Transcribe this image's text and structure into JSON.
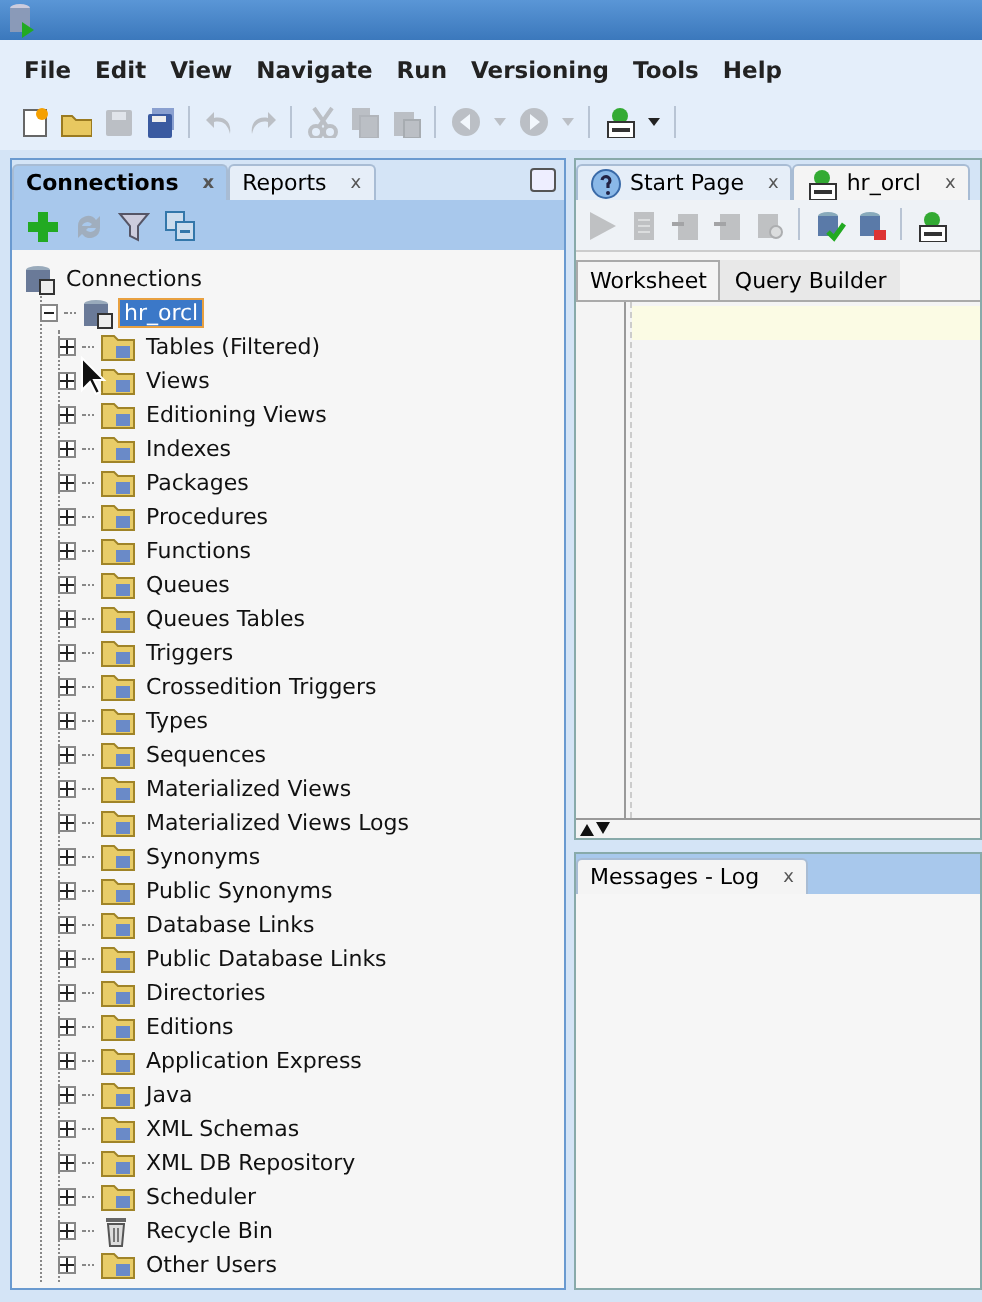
{
  "menu": [
    "File",
    "Edit",
    "View",
    "Navigate",
    "Run",
    "Versioning",
    "Tools",
    "Help"
  ],
  "toolbar": [
    {
      "kind": "new",
      "disabled": false
    },
    {
      "kind": "open",
      "disabled": false
    },
    {
      "kind": "save",
      "disabled": true
    },
    {
      "kind": "save-all",
      "disabled": false
    },
    {
      "kind": "sep"
    },
    {
      "kind": "undo",
      "disabled": true
    },
    {
      "kind": "redo",
      "disabled": true
    },
    {
      "kind": "sep"
    },
    {
      "kind": "cut",
      "disabled": true
    },
    {
      "kind": "copy",
      "disabled": true
    },
    {
      "kind": "paste",
      "disabled": true
    },
    {
      "kind": "sep"
    },
    {
      "kind": "back",
      "disabled": true
    },
    {
      "kind": "dropdown",
      "disabled": true
    },
    {
      "kind": "forward",
      "disabled": true
    },
    {
      "kind": "dropdown",
      "disabled": true
    },
    {
      "kind": "sep"
    },
    {
      "kind": "sql",
      "disabled": false
    },
    {
      "kind": "dropdown",
      "disabled": false
    },
    {
      "kind": "sep"
    }
  ],
  "left_panel": {
    "tabs": [
      {
        "label": "Connections",
        "selected": true,
        "close": "x"
      },
      {
        "label": "Reports",
        "selected": false,
        "close": "x"
      }
    ],
    "toolbar": [
      {
        "kind": "add",
        "disabled": false
      },
      {
        "kind": "refresh",
        "disabled": true
      },
      {
        "kind": "filter",
        "disabled": false
      },
      {
        "kind": "collapse",
        "disabled": false
      }
    ],
    "tree": [
      {
        "label": "Connections",
        "kind": "database",
        "selected": false,
        "children": [
          {
            "label": "hr_orcl",
            "kind": "database",
            "selected": true,
            "expanded": true,
            "children": [
              {
                "label": "Tables (Filtered)",
                "kind": "folder",
                "selected": false,
                "expanded": false
              },
              {
                "label": "Views",
                "kind": "folder",
                "selected": false,
                "expanded": false
              },
              {
                "label": "Editioning Views",
                "kind": "folder",
                "selected": false,
                "expanded": false
              },
              {
                "label": "Indexes",
                "kind": "folder",
                "selected": false,
                "expanded": false
              },
              {
                "label": "Packages",
                "kind": "folder",
                "selected": false,
                "expanded": false
              },
              {
                "label": "Procedures",
                "kind": "folder",
                "selected": false,
                "expanded": false
              },
              {
                "label": "Functions",
                "kind": "folder",
                "selected": false,
                "expanded": false
              },
              {
                "label": "Queues",
                "kind": "folder",
                "selected": false,
                "expanded": false
              },
              {
                "label": "Queues Tables",
                "kind": "folder",
                "selected": false,
                "expanded": false
              },
              {
                "label": "Triggers",
                "kind": "folder",
                "selected": false,
                "expanded": false
              },
              {
                "label": "Crossedition Triggers",
                "kind": "folder",
                "selected": false,
                "expanded": false
              },
              {
                "label": "Types",
                "kind": "folder",
                "selected": false,
                "expanded": false
              },
              {
                "label": "Sequences",
                "kind": "folder",
                "selected": false,
                "expanded": false
              },
              {
                "label": "Materialized Views",
                "kind": "folder",
                "selected": false,
                "expanded": false
              },
              {
                "label": "Materialized Views Logs",
                "kind": "folder",
                "selected": false,
                "expanded": false
              },
              {
                "label": "Synonyms",
                "kind": "folder",
                "selected": false,
                "expanded": false
              },
              {
                "label": "Public Synonyms",
                "kind": "folder",
                "selected": false,
                "expanded": false
              },
              {
                "label": "Database Links",
                "kind": "folder",
                "selected": false,
                "expanded": false
              },
              {
                "label": "Public Database Links",
                "kind": "folder",
                "selected": false,
                "expanded": false
              },
              {
                "label": "Directories",
                "kind": "folder",
                "selected": false,
                "expanded": false
              },
              {
                "label": "Editions",
                "kind": "folder",
                "selected": false,
                "expanded": false
              },
              {
                "label": "Application Express",
                "kind": "folder",
                "selected": false,
                "expanded": false
              },
              {
                "label": "Java",
                "kind": "folder",
                "selected": false,
                "expanded": false
              },
              {
                "label": "XML Schemas",
                "kind": "folder",
                "selected": false,
                "expanded": false
              },
              {
                "label": "XML DB Repository",
                "kind": "folder",
                "selected": false,
                "expanded": false
              },
              {
                "label": "Scheduler",
                "kind": "folder",
                "selected": false,
                "expanded": false
              },
              {
                "label": "Recycle Bin",
                "kind": "trash",
                "selected": false,
                "expanded": false
              },
              {
                "label": "Other Users",
                "kind": "folder",
                "selected": false,
                "expanded": false
              }
            ]
          }
        ]
      }
    ]
  },
  "editor": {
    "tabs": [
      {
        "label": "Start Page",
        "kind": "help",
        "selected": false,
        "close": "x"
      },
      {
        "label": "hr_orcl",
        "kind": "sql",
        "selected": true,
        "close": "x"
      }
    ],
    "toolbar": [
      {
        "kind": "run",
        "disabled": true
      },
      {
        "kind": "script",
        "disabled": true
      },
      {
        "kind": "step",
        "disabled": true
      },
      {
        "kind": "step",
        "disabled": true
      },
      {
        "kind": "explain",
        "disabled": true
      },
      {
        "kind": "sep"
      },
      {
        "kind": "commit",
        "disabled": false
      },
      {
        "kind": "rollback",
        "disabled": false
      },
      {
        "kind": "sep"
      },
      {
        "kind": "sql",
        "disabled": false
      }
    ],
    "subtabs": [
      {
        "label": "Worksheet",
        "selected": true
      },
      {
        "label": "Query Builder",
        "selected": false
      }
    ]
  },
  "messages": {
    "tabs": [
      {
        "label": "Messages - Log",
        "selected": true,
        "close": "x"
      }
    ]
  }
}
